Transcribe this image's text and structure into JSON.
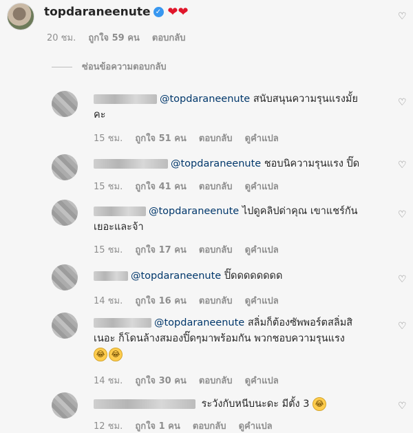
{
  "top_comment": {
    "username": "topdaraneenute",
    "hearts": "❤❤",
    "time": "20 ชม.",
    "likes": "ถูกใจ 59 คน",
    "reply_label": "ตอบกลับ"
  },
  "hide_replies_label": "ซ่อนข้อความตอบกลับ",
  "replies": [
    {
      "mention": "@topdaraneenute",
      "text_line1": "สนับสนุนความรุนแรงมั้ย",
      "text_line2": "คะ",
      "time": "15 ชม.",
      "likes": "ถูกใจ 51 คน",
      "reply_label": "ตอบกลับ",
      "translate_label": "ดูคำแปล"
    },
    {
      "mention": "@topdaraneenute",
      "text_line1": "ชอบนิความรุนแรง ปิ๊ด",
      "time": "15 ชม.",
      "likes": "ถูกใจ 41 คน",
      "reply_label": "ตอบกลับ",
      "translate_label": "ดูคำแปล"
    },
    {
      "mention": "@topdaraneenute",
      "text_line1": "ไปดูคลิปด่าคุณ เขาแชร์กัน",
      "text_line2": "เยอะและจ้า",
      "time": "15 ชม.",
      "likes": "ถูกใจ 17 คน",
      "reply_label": "ตอบกลับ",
      "translate_label": "ดูคำแปล"
    },
    {
      "mention": "@topdaraneenute",
      "text_line1": "ปิ๊ดดดดดดดด",
      "time": "14 ชม.",
      "likes": "ถูกใจ 16 คน",
      "reply_label": "ตอบกลับ",
      "translate_label": "ดูคำแปล"
    },
    {
      "mention": "@topdaraneenute",
      "text_line1": "สลิ่มก็ต้องซัพพอร์ตสลิ่มสิ",
      "text_line2": "เนอะ ก็โดนล้างสมองปิ๊ดๆมาพร้อมกัน พวกชอบความรุนแรง",
      "time": "14 ชม.",
      "likes": "ถูกใจ 30 คน",
      "reply_label": "ตอบกลับ",
      "translate_label": "ดูคำแปล"
    },
    {
      "mention": "",
      "text_line1": "ระวังกับหนีบนะดะ มีตั้ง 3",
      "time": "12 ชม.",
      "likes": "ถูกใจ 1 คน",
      "reply_label": "ตอบกลับ",
      "translate_label": "ดูคำแปล"
    }
  ]
}
